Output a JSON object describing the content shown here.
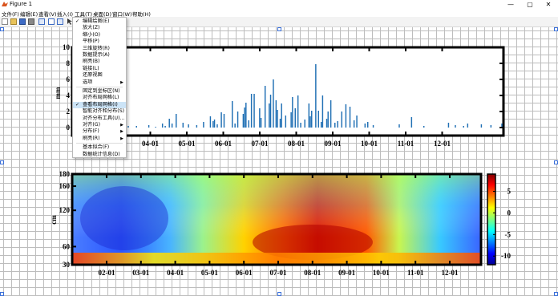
{
  "window": {
    "title": "Figure 1",
    "min": "—",
    "max": "▢",
    "close": "✕"
  },
  "menubar": [
    "文件(F)",
    "编辑(E)",
    "查看(V)",
    "插入(I)",
    "工具(T)",
    "桌面(D)",
    "窗口(W)",
    "帮助(H)"
  ],
  "context_menu": {
    "items": [
      {
        "label": "编辑绘图(E)",
        "checked": true
      },
      {
        "label": "放大(Z)"
      },
      {
        "label": "缩小(O)"
      },
      {
        "label": "平移(P)"
      },
      {
        "label": "三维旋转(R)"
      },
      {
        "label": "数据提示(A)"
      },
      {
        "label": "刷亮(B)"
      },
      {
        "label": "链接(L)"
      },
      {
        "label": "还原视图"
      },
      {
        "label": "选项",
        "submenu": true
      },
      {
        "label": "固定到坐标区(N)",
        "separator_before": true
      },
      {
        "label": "对齐布局网格(L)"
      },
      {
        "label": "查看布局网格(I)",
        "checked": true,
        "highlight": true
      },
      {
        "label": "智能对齐和分布(S)"
      },
      {
        "label": "对齐分布工具(U)..."
      },
      {
        "label": "对齐(G)",
        "submenu": true
      },
      {
        "label": "分布(F)",
        "submenu": true
      },
      {
        "label": "刷亮(R)",
        "submenu": true
      },
      {
        "label": "基本拟合(F)",
        "separator_before": true
      },
      {
        "label": "数据统计信息(D)"
      }
    ]
  },
  "chart_data": [
    {
      "type": "bar",
      "ylabel": "mm",
      "ylim": [
        -1,
        10
      ],
      "yticks": [
        0,
        2,
        4,
        6,
        8,
        10
      ],
      "xtick_labels": [
        "03-01",
        "04-01",
        "05-01",
        "06-01",
        "07-01",
        "08-01",
        "09-01",
        "10-01",
        "11-01",
        "12-01"
      ],
      "bar_color": "#1f6fb4",
      "values": [
        0.2,
        0,
        0,
        0,
        0.6,
        0,
        1.4,
        0,
        0,
        0.3,
        0,
        0,
        0,
        0,
        0.5,
        0,
        0,
        0.2,
        0,
        0,
        0,
        0,
        0,
        0.4,
        0,
        0,
        0,
        0,
        0.8,
        0,
        0,
        0,
        0.2,
        0,
        0,
        0,
        0.5,
        0,
        0,
        0,
        0.2,
        0,
        0,
        0,
        0,
        0,
        0.2,
        0,
        0,
        0,
        0,
        0,
        0,
        0,
        0,
        0.3,
        0,
        0,
        0,
        0,
        0.1,
        0,
        0,
        0,
        0,
        0.5,
        0,
        0.2,
        0,
        0,
        1.1,
        0,
        0.5,
        0,
        0,
        1.7,
        0,
        0,
        0,
        0,
        0.6,
        0,
        0,
        0,
        0.4,
        0,
        0,
        0,
        0,
        0,
        0.3,
        0,
        0,
        0,
        0,
        0.7,
        0,
        0,
        0,
        0,
        1.4,
        0,
        0.8,
        1.0,
        0,
        0.4,
        0,
        0,
        1.9,
        0,
        1.7,
        0,
        0,
        0,
        0,
        0,
        3.3,
        0,
        0.5,
        0,
        2.0,
        0,
        0,
        0,
        1.7,
        2.5,
        3.1,
        0,
        0.9,
        0,
        4.2,
        0,
        4.2,
        0,
        0,
        0,
        2.4,
        1.2,
        0,
        0,
        5.2,
        0,
        0,
        3.0,
        4.1,
        0,
        6.0,
        0,
        3.4,
        2.2,
        0,
        1.1,
        3.0,
        0,
        0,
        1.5,
        0,
        0,
        0,
        1.9,
        3.8,
        0,
        2.4,
        0,
        4.0,
        0,
        0.6,
        0,
        0,
        1.0,
        0,
        0,
        3.0,
        1.4,
        2.1,
        0,
        0,
        7.9,
        0,
        2.1,
        0,
        0.7,
        4.0,
        0,
        0,
        1.1,
        2.0,
        0,
        3.4,
        0,
        0,
        0.6,
        0,
        0.8,
        0,
        0,
        2.0,
        0,
        0,
        2.9,
        0,
        0,
        2.6,
        0,
        0,
        0.9,
        0,
        1.5,
        0,
        0,
        0,
        0,
        0,
        0.5,
        0,
        0.7,
        0,
        0,
        0,
        0.3,
        0,
        0,
        0,
        0,
        0,
        0,
        0,
        0,
        0,
        0,
        0,
        0,
        0,
        0,
        0,
        0,
        0,
        0,
        0.4,
        0,
        0,
        0,
        0,
        0,
        0,
        0,
        0,
        1.3,
        0,
        0,
        0,
        0,
        0,
        0,
        0,
        0,
        0.2,
        0,
        0,
        0,
        0,
        0,
        0,
        0,
        0,
        0,
        0,
        0,
        0,
        0,
        0,
        0,
        0,
        0,
        0.6,
        0,
        0,
        0,
        0,
        0.3,
        0,
        0,
        0,
        0,
        0,
        0.2,
        0,
        0,
        0.5,
        0,
        0,
        0,
        0,
        0,
        0,
        0,
        0,
        0,
        0.4,
        0,
        0,
        0,
        0,
        0,
        0,
        0.3,
        0,
        0,
        0,
        0,
        0,
        0,
        0,
        0.5
      ]
    },
    {
      "type": "heatmap",
      "ylabel": "cm",
      "ylim": [
        30,
        180
      ],
      "yticks": [
        30,
        60,
        120,
        160,
        180
      ],
      "xtick_labels": [
        "02-01",
        "03-01",
        "04-01",
        "05-01",
        "06-01",
        "07-01",
        "08-01",
        "09-01",
        "10-01",
        "11-01",
        "12-01"
      ],
      "colorbar_ticks": [
        5,
        0,
        -5,
        -10
      ],
      "colormap": "jet",
      "clim": [
        -12,
        9
      ]
    }
  ]
}
